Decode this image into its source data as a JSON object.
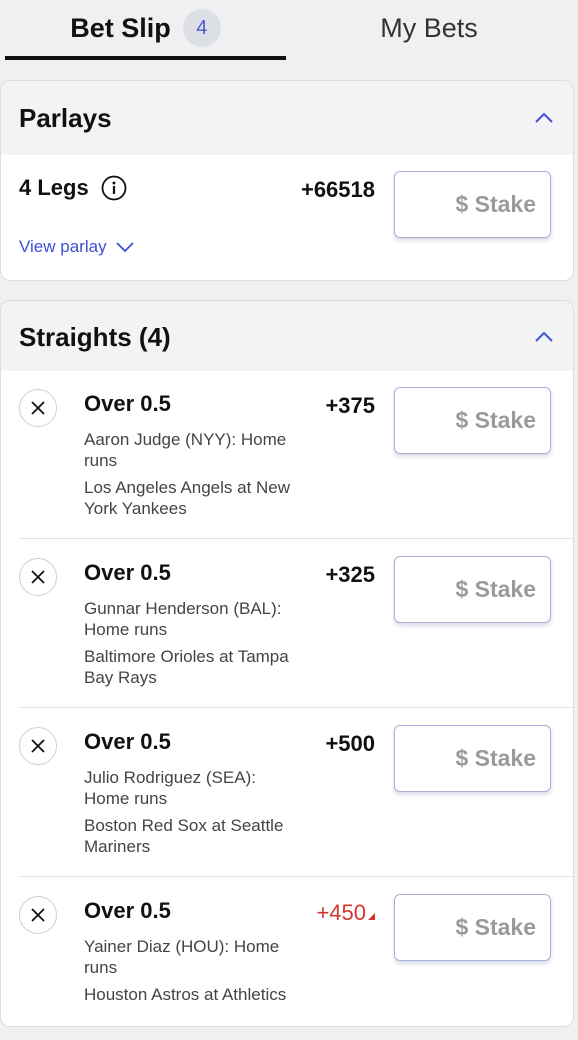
{
  "tabs": {
    "bet_slip": "Bet Slip",
    "bet_slip_count": "4",
    "my_bets": "My Bets"
  },
  "parlays": {
    "title": "Parlays",
    "legs_label": "4 Legs",
    "odds": "+66518",
    "stake_placeholder": "$ Stake",
    "view_parlay": "View parlay"
  },
  "straights": {
    "title": "Straights (4)",
    "legs": [
      {
        "title": "Over 0.5",
        "market": "Aaron Judge (NYY): Home runs",
        "event": "Los Angeles Angels at New York Yankees",
        "odds": "+375",
        "odds_changed": false,
        "stake_placeholder": "$ Stake"
      },
      {
        "title": "Over 0.5",
        "market": "Gunnar Henderson (BAL): Home runs",
        "event": "Baltimore Orioles at Tampa Bay Rays",
        "odds": "+325",
        "odds_changed": false,
        "stake_placeholder": "$ Stake"
      },
      {
        "title": "Over 0.5",
        "market": "Julio Rodriguez (SEA): Home runs",
        "event": "Boston Red Sox at Seattle Mariners",
        "odds": "+500",
        "odds_changed": false,
        "stake_placeholder": "$ Stake"
      },
      {
        "title": "Over 0.5",
        "market": "Yainer Diaz (HOU): Home runs",
        "event": "Houston Astros at Athletics",
        "odds": "+450",
        "odds_changed": true,
        "stake_placeholder": "$ Stake"
      }
    ]
  },
  "colors": {
    "accent": "#3d4fd6",
    "odds_up": "#d6362e",
    "badge_bg": "#dcdfe6"
  },
  "icons": {
    "collapse": "chevron-up-icon",
    "info": "info-icon",
    "expand": "chevron-down-icon",
    "remove": "close-icon",
    "odds_change": "triangle-up-icon"
  }
}
